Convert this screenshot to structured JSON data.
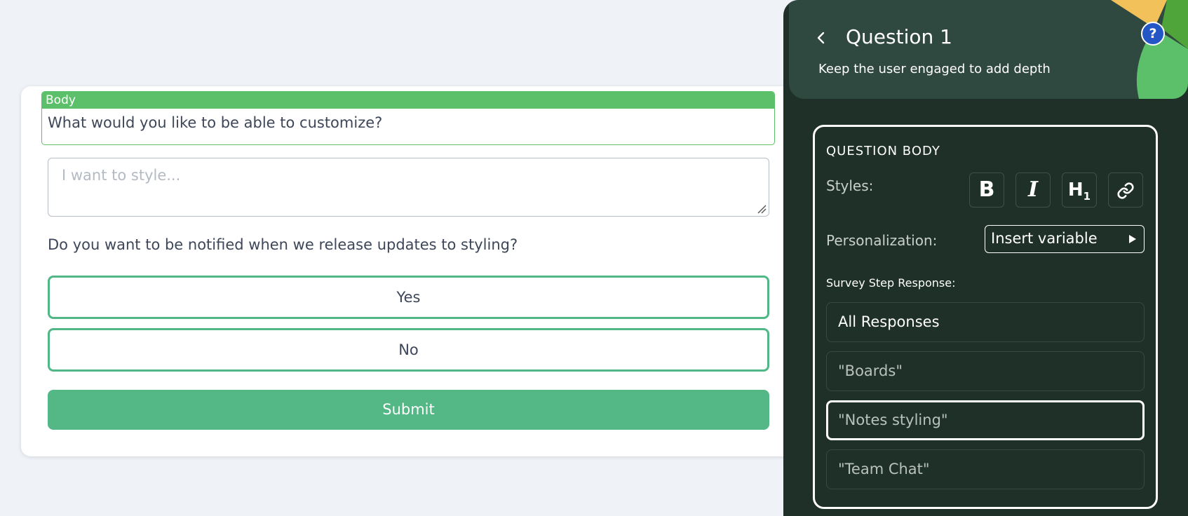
{
  "preview": {
    "body_tag": "Body",
    "question_text": "What would you like to be able to customize?",
    "textarea_placeholder": "I want to style...",
    "question2_text": "Do you want to be notified when we release updates to styling?",
    "options": [
      "Yes",
      "No"
    ],
    "submit_label": "Submit"
  },
  "panel": {
    "title": "Question 1",
    "subtitle": "Keep the user engaged to add depth",
    "help_label": "?",
    "section_heading": "QUESTION BODY",
    "styles_label": "Styles:",
    "tools": {
      "bold": "B",
      "italic": "I",
      "heading": "H",
      "heading_sub": "1"
    },
    "personalization_label": "Personalization:",
    "personalization_value": "Insert variable",
    "survey_step_label": "Survey Step Response:",
    "responses": [
      "All Responses",
      "\"Boards\"",
      "\"Notes styling\"",
      "\"Team Chat\""
    ],
    "selected_response": "\"Notes styling\""
  },
  "colors": {
    "accent_green": "#52b786",
    "body_tag_green": "#5cc06a",
    "panel_bg": "#1f3029",
    "panel_header_bg": "#304940",
    "help_blue": "#2457c5"
  },
  "icons": [
    "back-chevron-icon",
    "help-icon",
    "bold-icon",
    "italic-icon",
    "heading-icon",
    "link-icon",
    "play-arrow-icon",
    "resize-grip-icon"
  ]
}
